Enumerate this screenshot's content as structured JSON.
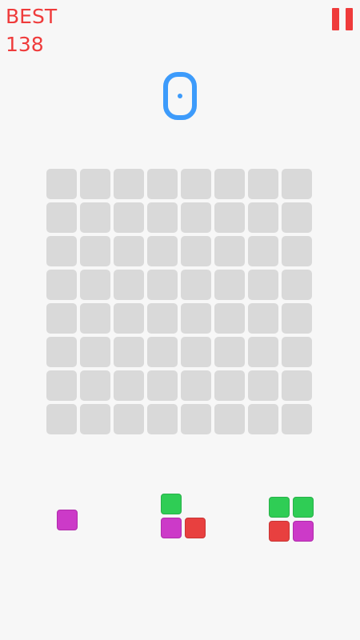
{
  "hud": {
    "best_label": "BEST",
    "best_value": "138",
    "score": "0",
    "pause_icon": "pause-icon"
  },
  "colors": {
    "accent_red": "#ef3b3b",
    "score_blue": "#3d9bfb",
    "empty_cell": "#d9d9d9",
    "block_magenta": "#cc3ac8",
    "block_green": "#2fcd55",
    "block_red": "#e8403f"
  },
  "board": {
    "rows": 8,
    "cols": 8,
    "filled_cells": 0
  },
  "tray": {
    "pieces": [
      {
        "name": "single-square",
        "blocks": [
          "magenta"
        ]
      },
      {
        "name": "l-tromino",
        "blocks": [
          "green",
          "magenta",
          "red"
        ]
      },
      {
        "name": "square-tetromino",
        "blocks": [
          "green",
          "green",
          "red",
          "magenta"
        ]
      }
    ]
  }
}
